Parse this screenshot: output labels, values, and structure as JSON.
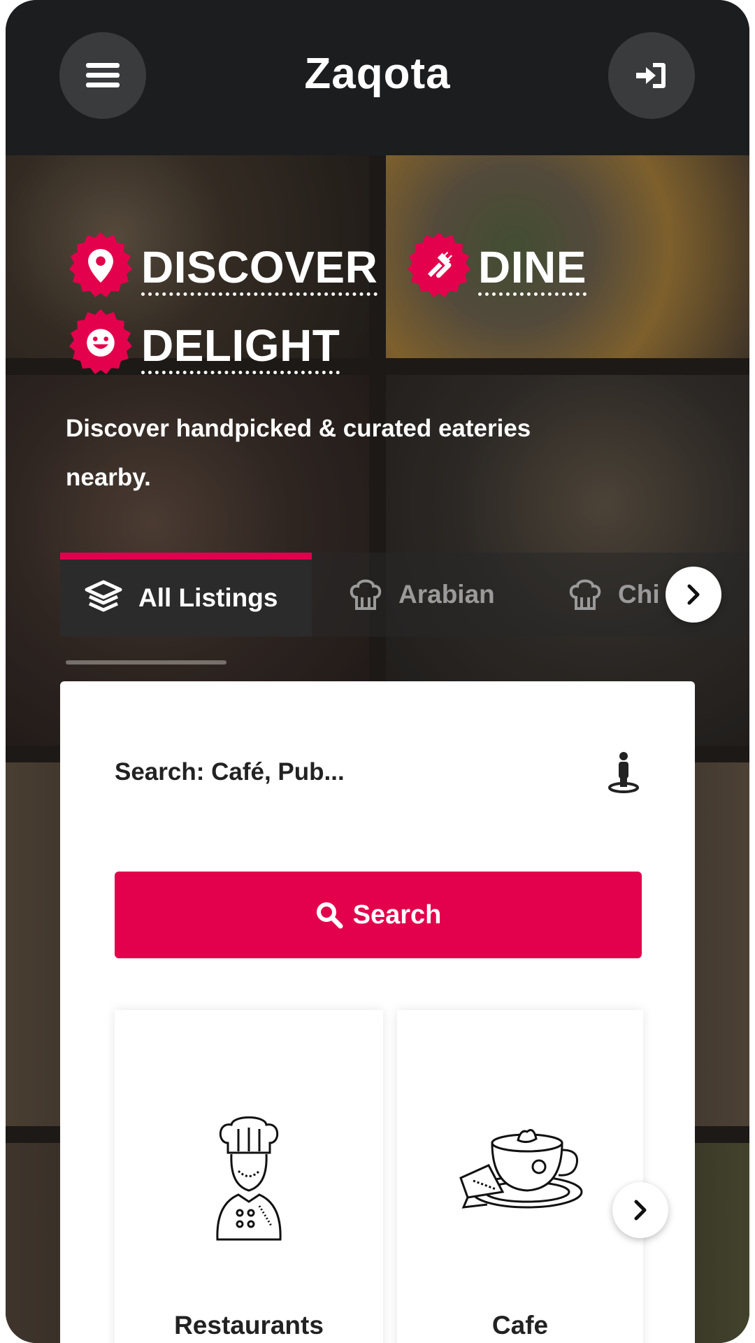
{
  "header": {
    "brand": "Zaqota",
    "menu_icon": "hamburger-menu-icon",
    "login_icon": "sign-in-icon"
  },
  "hero": {
    "headline_1": "DISCOVER",
    "headline_2": "DINE",
    "headline_3": "DELIGHT",
    "tagline": "Discover handpicked & curated eateries nearby.",
    "accent_color": "#e3004c"
  },
  "tabs": {
    "items": [
      {
        "label": "All Listings",
        "icon": "layers-icon",
        "active": true
      },
      {
        "label": "Arabian",
        "icon": "chef-hat-icon",
        "active": false
      },
      {
        "label": "Chi",
        "icon": "chef-hat-icon",
        "active": false
      }
    ],
    "next_icon": "chevron-right-icon"
  },
  "search": {
    "placeholder": "Search: Café, Pub...",
    "location_icon": "street-view-icon",
    "button_label": "Search",
    "button_icon": "search-icon"
  },
  "categories": {
    "items": [
      {
        "label": "Restaurants",
        "illustration": "chef-illustration"
      },
      {
        "label": "Cafe",
        "illustration": "coffee-cup-illustration"
      }
    ],
    "next_icon": "chevron-right-icon"
  }
}
